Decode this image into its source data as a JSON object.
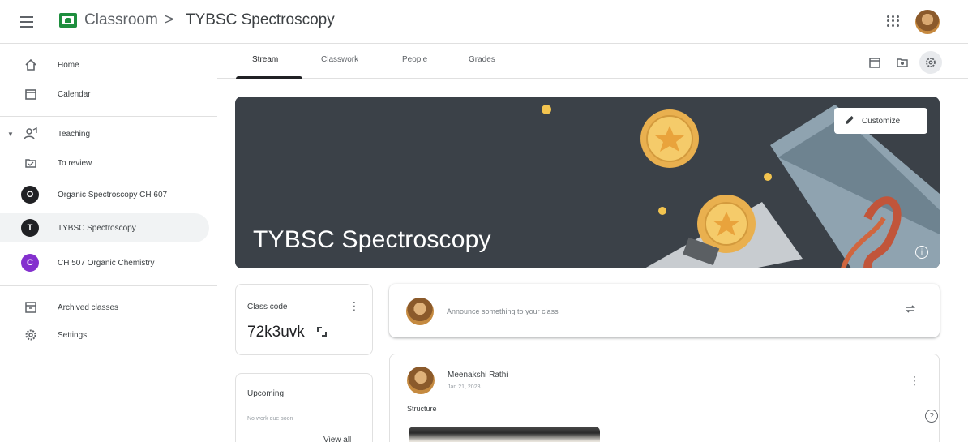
{
  "header": {
    "app_name": "Classroom",
    "separator": ">",
    "class_name": "TYBSC Spectroscopy"
  },
  "sidebar": {
    "items": [
      {
        "label": "Home",
        "icon": "home-icon"
      },
      {
        "label": "Calendar",
        "icon": "calendar-icon"
      },
      {
        "label": "Teaching",
        "icon": "teaching-icon"
      },
      {
        "label": "To review",
        "icon": "to-review-icon"
      },
      {
        "label": "Organic Spectroscopy CH 607",
        "badge": "O",
        "badge_color": "#202124"
      },
      {
        "label": "TYBSC Spectroscopy",
        "badge": "T",
        "badge_color": "#202124",
        "active": true
      },
      {
        "label": "CH 507 Organic Chemistry",
        "badge": "C",
        "badge_color": "#8430ce"
      },
      {
        "label": "Archived classes",
        "icon": "archive-icon"
      },
      {
        "label": "Settings",
        "icon": "settings-icon"
      }
    ]
  },
  "tabs": [
    {
      "label": "Stream",
      "active": true
    },
    {
      "label": "Classwork"
    },
    {
      "label": "People"
    },
    {
      "label": "Grades"
    }
  ],
  "banner": {
    "title": "TYBSC Spectroscopy",
    "customize_label": "Customize",
    "background_color": "#3b4148"
  },
  "class_code": {
    "label": "Class code",
    "value": "72k3uvk"
  },
  "upcoming": {
    "title": "Upcoming",
    "note": "No work due soon",
    "link": "View all"
  },
  "announce": {
    "placeholder": "Announce something to your class"
  },
  "post": {
    "author": "Meenakshi Rathi",
    "date": "Jan 21, 2023",
    "body": "Structure"
  }
}
